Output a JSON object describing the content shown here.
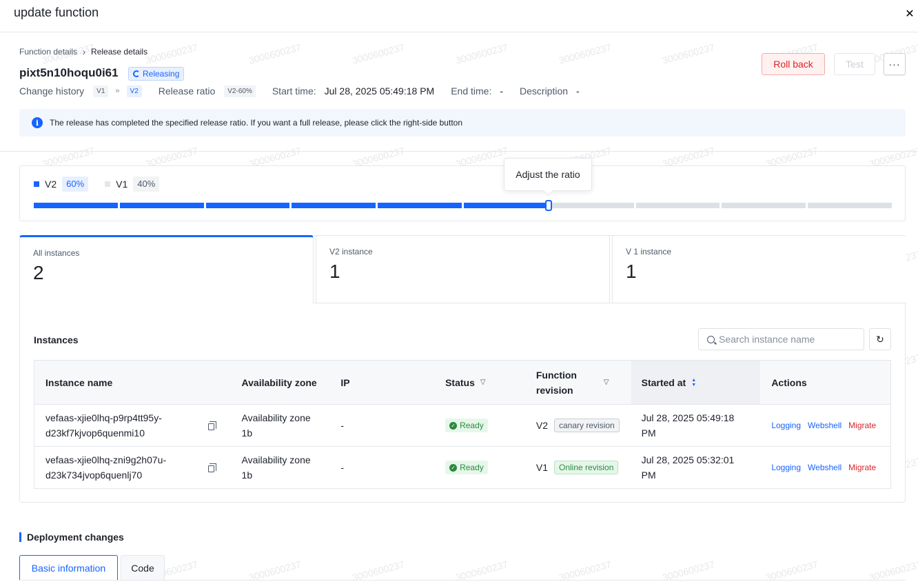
{
  "dialog": {
    "title": "update function",
    "close_icon": "close-icon"
  },
  "breadcrumb": {
    "parent": "Function details",
    "current": "Release details"
  },
  "function": {
    "name": "pixt5n10hoqu0i61",
    "status": "Releasing"
  },
  "meta": {
    "change_history_label": "Change history",
    "from_version": "V1",
    "to_version": "V2",
    "release_ratio_label": "Release ratio",
    "release_ratio_value": "V2-60%",
    "start_time_label": "Start time:",
    "start_time_value": "Jul 28, 2025 05:49:18 PM",
    "end_time_label": "End time:",
    "end_time_value": "-",
    "description_label": "Description",
    "description_value": "-"
  },
  "actions": {
    "rollback": "Roll back",
    "test": "Test",
    "more": "···"
  },
  "alert": {
    "text": "The release has completed the specified release ratio. If you want a full release, please click the right-side button"
  },
  "ratio": {
    "v2_label": "V2",
    "v2_percent": "60%",
    "v2_fraction": 0.6,
    "v1_label": "V1",
    "v1_percent": "40%",
    "tooltip": "Adjust the ratio",
    "segments": 10,
    "colors": {
      "v2": "#1664ff",
      "v1": "#dde1e6"
    }
  },
  "instance_tabs": [
    {
      "label": "All instances",
      "count": "2"
    },
    {
      "label": "V2 instance",
      "count": "1"
    },
    {
      "label": "V 1 instance",
      "count": "1"
    }
  ],
  "instances": {
    "title": "Instances",
    "search_placeholder": "Search instance name",
    "columns": {
      "name": "Instance name",
      "zone": "Availability zone",
      "ip": "IP",
      "status": "Status",
      "revision": "Function revision",
      "started": "Started at",
      "actions": "Actions"
    },
    "rows": [
      {
        "name_line1": "vefaas-xjie0lhq-p9rp4tt95y-",
        "name_line2": "d23kf7kjvop6quenmi10",
        "zone_line1": "Availability zone",
        "zone_line2": "1b",
        "ip": "-",
        "status": "Ready",
        "revision": "V2",
        "revision_tag": "canary revision",
        "started_line1": "Jul 28, 2025 05:49:18",
        "started_line2": "PM",
        "act_logging": "Logging",
        "act_webshell": "Webshell",
        "act_migrate": "Migrate"
      },
      {
        "name_line1": "vefaas-xjie0lhq-zni9g2h07u-",
        "name_line2": "d23k734jvop6quenlj70",
        "zone_line1": "Availability zone",
        "zone_line2": "1b",
        "ip": "-",
        "status": "Ready",
        "revision": "V1",
        "revision_tag": "Online revision",
        "started_line1": "Jul 28, 2025 05:32:01",
        "started_line2": "PM",
        "act_logging": "Logging",
        "act_webshell": "Webshell",
        "act_migrate": "Migrate"
      }
    ]
  },
  "deployment": {
    "title": "Deployment changes",
    "tab_basic": "Basic information",
    "tab_code": "Code"
  },
  "watermark": "3000600237"
}
